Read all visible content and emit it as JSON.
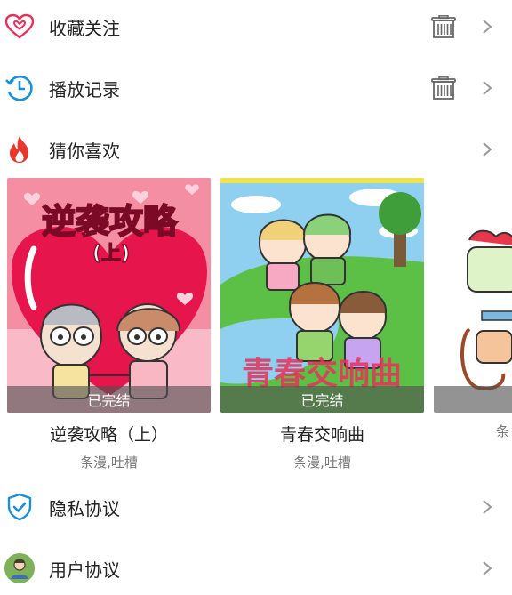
{
  "menu": {
    "favorites": {
      "label": "收藏关注",
      "icon": "heart-icon",
      "delete_icon": "trash-icon"
    },
    "history": {
      "label": "播放记录",
      "icon": "history-clock-icon",
      "delete_icon": "trash-icon"
    },
    "recommend": {
      "label": "猜你喜欢",
      "icon": "flame-icon"
    },
    "privacy": {
      "label": "隐私协议",
      "icon": "shield-check-icon"
    },
    "user_agreement": {
      "label": "用户协议",
      "icon": "user-avatar-icon"
    }
  },
  "recommendations": [
    {
      "title": "逆袭攻略（上）",
      "cover_text": "逆袭攻略",
      "cover_sub": "(上)",
      "status": "已完结",
      "tags": "条漫,吐槽"
    },
    {
      "title": "青春交响曲",
      "cover_text": "青春交响曲",
      "status": "已完结",
      "tags": "条漫,吐槽"
    },
    {
      "title": "",
      "status": "",
      "tags": "条"
    }
  ],
  "colors": {
    "accent_pink": "#e8315a",
    "accent_blue": "#1a8fd8",
    "flame_red": "#e8372c",
    "chevron_gray": "#999999"
  }
}
